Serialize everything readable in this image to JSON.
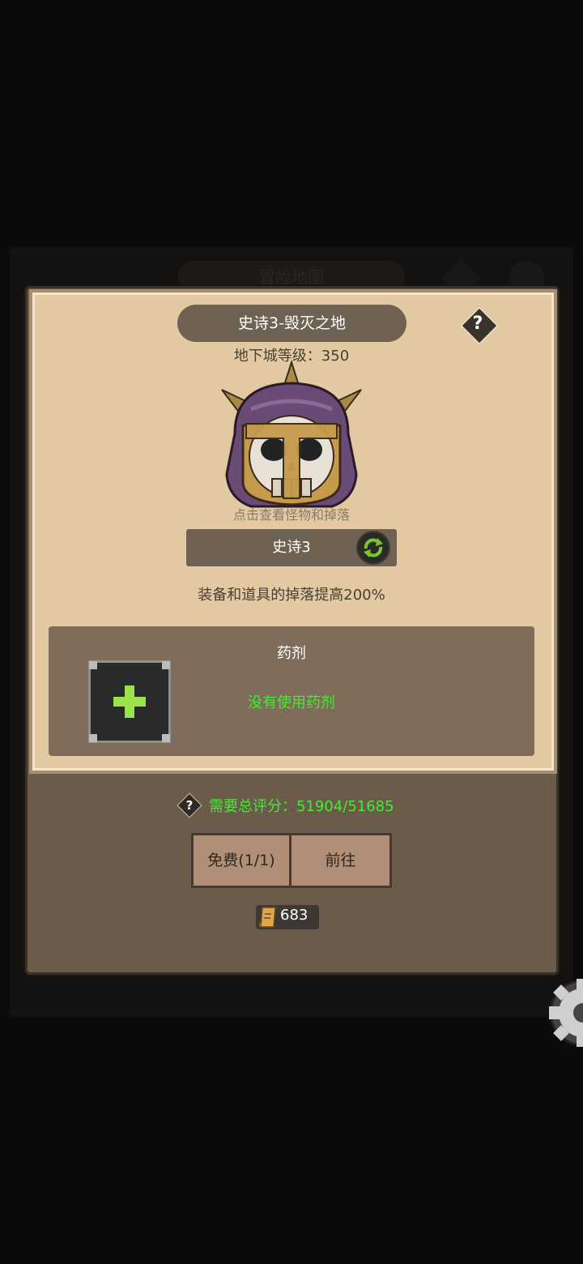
{
  "background": {
    "title": "冒险地图"
  },
  "dialog": {
    "stage_title": "史诗3-毁灭之地",
    "help_symbol": "?",
    "dungeon_level": "地下城等级：350",
    "boss_hint": "点击查看怪物和掉落",
    "difficulty": "史诗3",
    "drop_bonus": "装备和道具的掉落提高200%",
    "potion": {
      "title": "药剂",
      "status": "没有使用药剂"
    }
  },
  "requirement": {
    "help_symbol": "?",
    "text": "需要总评分：51904/51685"
  },
  "buttons": {
    "free": "免费(1/1)",
    "go": "前往"
  },
  "currency": {
    "scroll_count": "683"
  },
  "colors": {
    "green_text": "#3df02c",
    "parchment": "#e2c9a1",
    "panel": "#6b5b4b"
  }
}
